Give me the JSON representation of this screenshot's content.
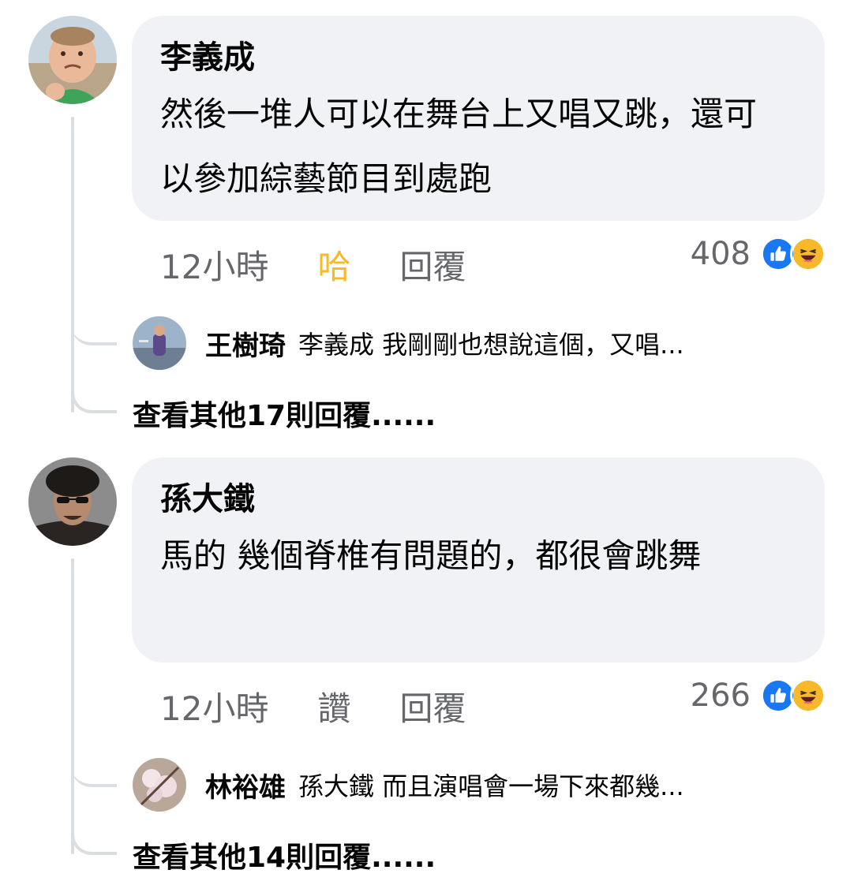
{
  "comments": [
    {
      "author": "李義成",
      "text": "然後一堆人可以在舞台上又唱又跳，還可以參加綜藝節目到處跑",
      "time": "12小時",
      "reaction_label": "哈",
      "reply_label": "回覆",
      "reaction_count": "408",
      "reactions": [
        "like-icon",
        "haha-icon"
      ],
      "reply_preview": {
        "author": "王樹琦",
        "text": "李義成 我剛剛也想說這個，又唱..."
      },
      "view_more": "查看其他17則回覆......"
    },
    {
      "author": "孫大鐵",
      "text": "馬的 幾個脊椎有問題的，都很會跳舞",
      "time": "12小時",
      "reaction_label": "讚",
      "reply_label": "回覆",
      "reaction_count": "266",
      "reactions": [
        "like-icon",
        "haha-icon"
      ],
      "reply_preview": {
        "author": "林裕雄",
        "text": "孫大鐵 而且演唱會一場下來都幾..."
      },
      "view_more": "查看其他14則回覆......"
    }
  ],
  "colors": {
    "bubble": "#f0f2f5",
    "secondary_text": "#65676b",
    "haha_active": "#f7b928",
    "like_blue": "#1877f2",
    "thread_line": "#dadde1"
  }
}
